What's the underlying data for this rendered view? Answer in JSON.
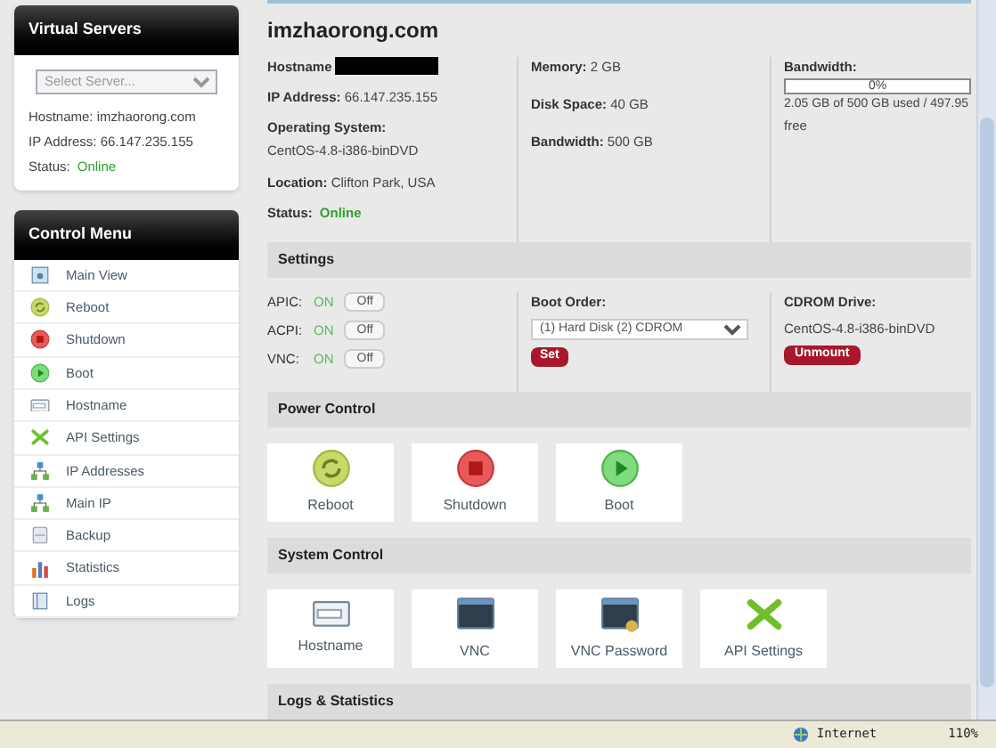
{
  "sidebar": {
    "virtual_servers": {
      "title": "Virtual Servers",
      "select": {
        "placeholder": "Select Server..."
      },
      "hostname": {
        "label": "Hostname:",
        "value": "imzhaorong.com"
      },
      "ip": {
        "label": "IP Address:",
        "value": "66.147.235.155"
      },
      "status": {
        "label": "Status:",
        "value": "Online"
      }
    },
    "control_menu": {
      "title": "Control Menu",
      "items": [
        {
          "label": "Main View",
          "kind": "view"
        },
        {
          "label": "Reboot",
          "kind": "reboot"
        },
        {
          "label": "Shutdown",
          "kind": "shutdown"
        },
        {
          "label": "Boot",
          "kind": "boot"
        },
        {
          "label": "Hostname",
          "kind": "hostname"
        },
        {
          "label": "API Settings",
          "kind": "api"
        },
        {
          "label": "IP Addresses",
          "kind": "network"
        },
        {
          "label": "Main IP",
          "kind": "network"
        },
        {
          "label": "Backup",
          "kind": "backup"
        },
        {
          "label": "Statistics",
          "kind": "stats"
        },
        {
          "label": "Logs",
          "kind": "logs"
        }
      ]
    }
  },
  "server": {
    "title": "imzhaorong.com",
    "hostname_label": "Hostname",
    "ip": {
      "label": "IP Address:",
      "value": "66.147.235.155"
    },
    "os": {
      "label": "Operating System:",
      "value": "CentOS-4.8-i386-binDVD"
    },
    "location": {
      "label": "Location:",
      "value": "Clifton Park, USA"
    },
    "status": {
      "label": "Status:",
      "value": "Online"
    },
    "memory": {
      "label": "Memory:",
      "value": "2 GB"
    },
    "disk": {
      "label": "Disk Space:",
      "value": "40 GB"
    },
    "bandwidth": {
      "label": "Bandwidth:",
      "value": "500 GB"
    },
    "bandwidth_usage": {
      "label": "Bandwidth:",
      "level": 0,
      "reading": "0%",
      "detail": "2.05 GB of 500 GB used / 497.95",
      "detail_2": "free"
    }
  },
  "settings": {
    "title": "Settings",
    "toggles": [
      {
        "label": "APIC:",
        "state_text": "ON",
        "button": "Off",
        "on": true
      },
      {
        "label": "ACPI:",
        "state_text": "ON",
        "button": "Off",
        "on": true
      },
      {
        "label": "VNC:",
        "state_text": "ON",
        "button": "Off",
        "on": true
      }
    ],
    "boot_order": {
      "label": "Boot Order:",
      "value": "(1) Hard Disk (2) CDROM",
      "button": "Set"
    },
    "cdrom": {
      "label": "CDROM Drive:",
      "value": "CentOS-4.8-i386-binDVD",
      "button": "Unmount"
    }
  },
  "power_control": {
    "title": "Power Control",
    "tiles": [
      {
        "label": "Reboot",
        "kind": "reboot"
      },
      {
        "label": "Shutdown",
        "kind": "shutdown"
      },
      {
        "label": "Boot",
        "kind": "boot"
      }
    ]
  },
  "system_control": {
    "title": "System Control",
    "tiles": [
      {
        "label": "Hostname",
        "kind": "hostname"
      },
      {
        "label": "VNC",
        "kind": "vnc"
      },
      {
        "label": "VNC Password",
        "kind": "vnc-password"
      },
      {
        "label": "API Settings",
        "kind": "api"
      }
    ]
  },
  "logs_statistics": {
    "title": "Logs & Statistics"
  },
  "status_bar": {
    "zone": "Internet",
    "zoom": "110%"
  }
}
